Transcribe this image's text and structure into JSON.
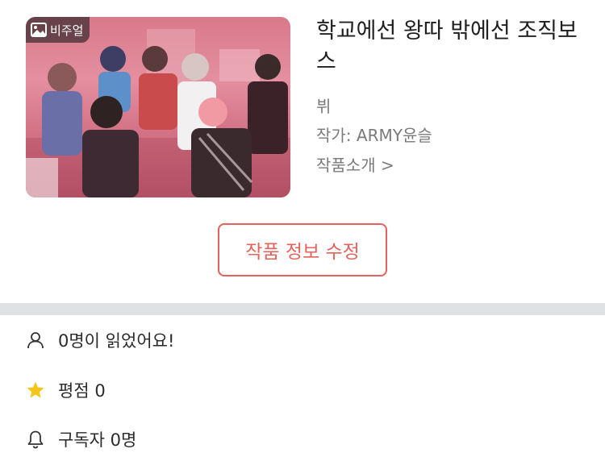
{
  "work": {
    "title": "학교에선 왕따 밖에선 조직보스",
    "character": "뷔",
    "author": "작가: ARMY윤슬",
    "intro_link": "작품소개 >",
    "cover_badge": "비주얼",
    "edit_button": "작품 정보 수정"
  },
  "stats": {
    "readers": "0명이 읽었어요!",
    "rating": "평점 0",
    "subscribers": "구독자 0명"
  },
  "colors": {
    "accent": "#e5625c",
    "star": "#f5c518",
    "divider": "#dfe1e5",
    "muted_text": "#7a7a7a"
  },
  "icons": {
    "badge": "image-icon",
    "readers": "user-icon",
    "rating": "star-icon",
    "subscribers": "bell-icon"
  }
}
